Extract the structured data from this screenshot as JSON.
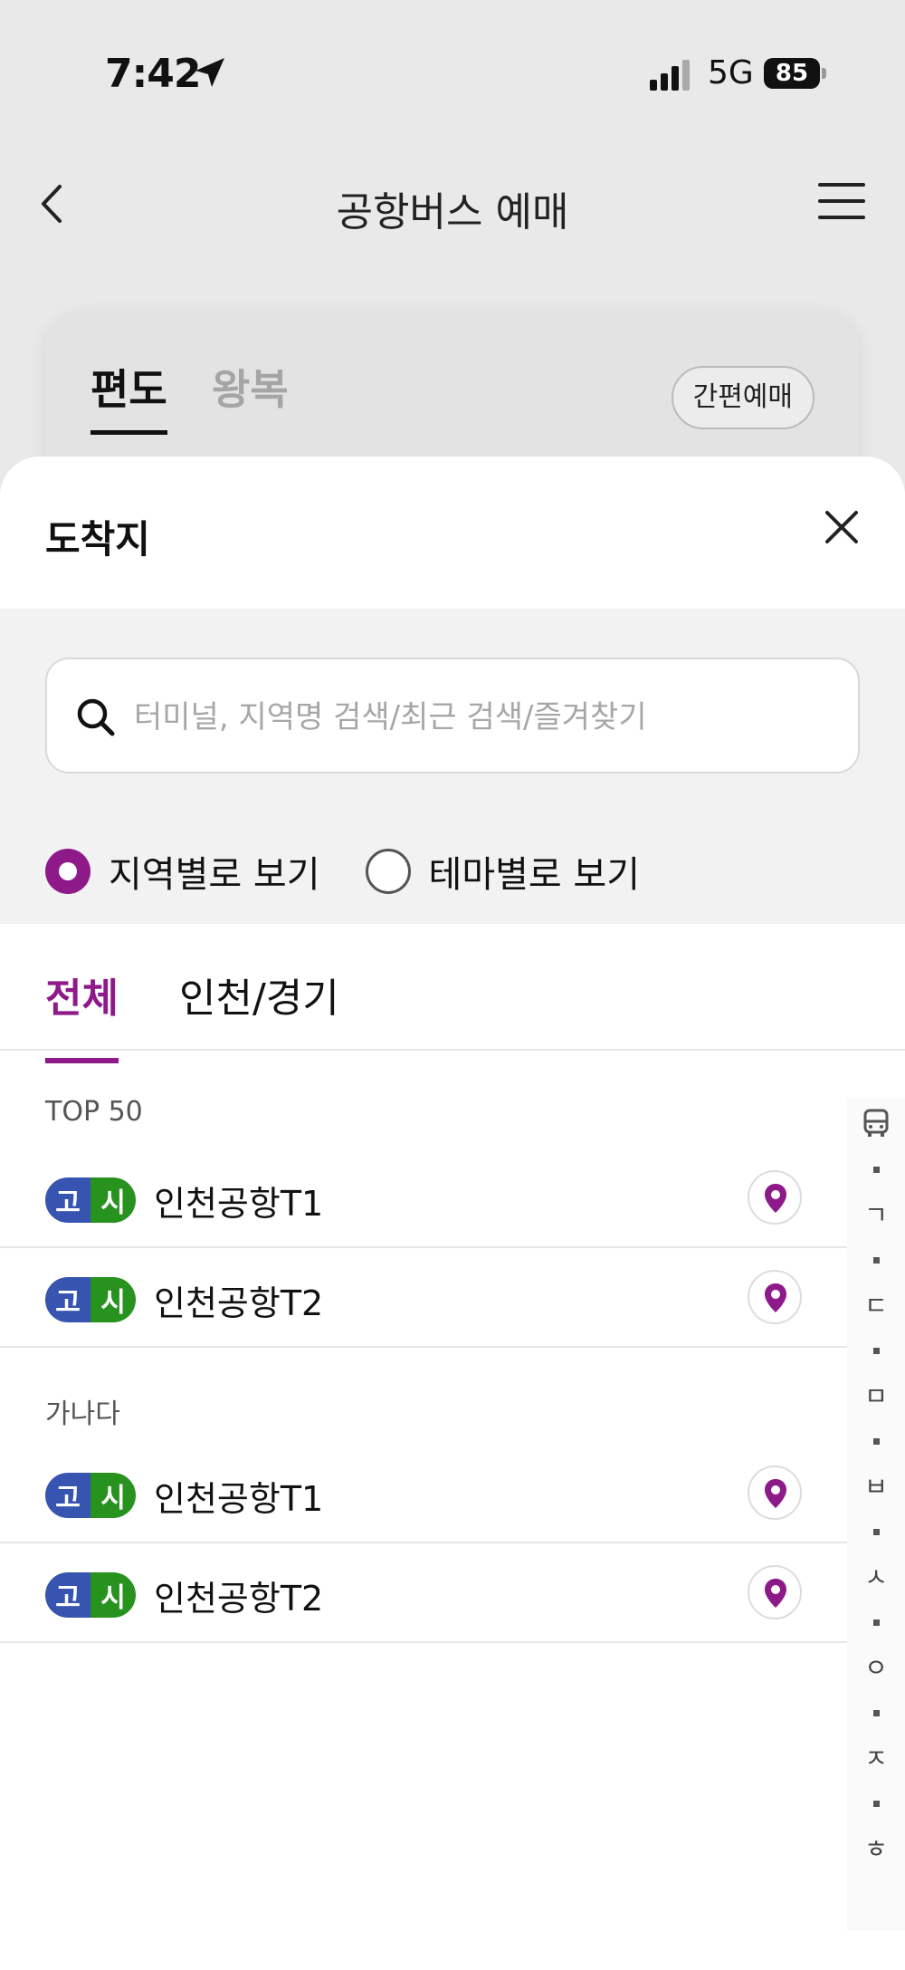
{
  "status_bar": {
    "time": "7:42",
    "network": "5G",
    "battery": "85"
  },
  "header": {
    "title": "공항버스 예매"
  },
  "trip_card": {
    "tabs": [
      "편도",
      "왕복"
    ],
    "active_tab": "편도",
    "quick_booking": "간편예매"
  },
  "sheet": {
    "title": "도착지",
    "search": {
      "placeholder": "터미널, 지역명 검색/최근 검색/즐겨찾기",
      "value": ""
    },
    "view_options": [
      {
        "label": "지역별로 보기",
        "selected": true
      },
      {
        "label": "테마별로 보기",
        "selected": false
      }
    ],
    "region_tabs": [
      "전체",
      "인천/경기"
    ],
    "active_region": "전체",
    "sections": [
      {
        "label": "TOP 50",
        "items": [
          {
            "badges": [
              "고",
              "시"
            ],
            "name": "인천공항T1"
          },
          {
            "badges": [
              "고",
              "시"
            ],
            "name": "인천공항T2"
          }
        ]
      },
      {
        "label": "가나다",
        "items": [
          {
            "badges": [
              "고",
              "시"
            ],
            "name": "인천공항T1"
          },
          {
            "badges": [
              "고",
              "시"
            ],
            "name": "인천공항T2"
          }
        ]
      }
    ],
    "index": [
      "bus-icon",
      "ㄱ",
      "ㄷ",
      "ㅁ",
      "ㅂ",
      "ㅅ",
      "ㅇ",
      "ㅈ",
      "ㅎ"
    ]
  },
  "colors": {
    "accent": "#8e1a8a",
    "badge_express": "#3755b0",
    "badge_city": "#28921e"
  }
}
